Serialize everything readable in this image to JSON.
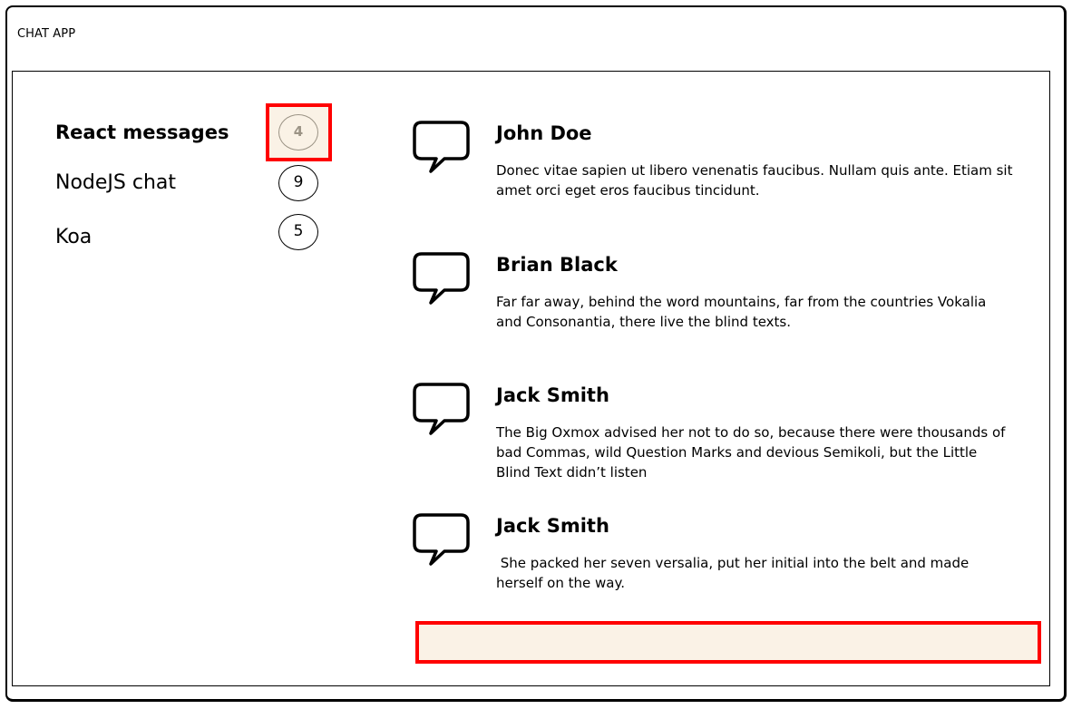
{
  "app": {
    "title": "CHAT APP"
  },
  "sidebar": {
    "channels": [
      {
        "name": "React messages",
        "count": "4",
        "active": true
      },
      {
        "name": "NodeJS chat",
        "count": "9",
        "active": false
      },
      {
        "name": "Koa",
        "count": "5",
        "active": false
      }
    ]
  },
  "messages": [
    {
      "icon": "speech-bubble-icon",
      "author": "John Doe",
      "text": "Donec vitae sapien ut libero venenatis faucibus. Nullam quis ante. Etiam sit amet orci eget eros faucibus tincidunt."
    },
    {
      "icon": "speech-bubble-icon",
      "author": "Brian Black",
      "text": "Far far away, behind the word mountains, far from the countries Vokalia and Consonantia, there live the blind texts."
    },
    {
      "icon": "speech-bubble-icon",
      "author": "Jack Smith",
      "text": "The Big Oxmox advised her not to do so, because there were thousands of bad Commas, wild Question Marks and devious Semikoli, but the Little Blind Text didn’t listen"
    },
    {
      "icon": "speech-bubble-icon",
      "author": "Jack Smith",
      "text": " She packed her seven versalia, put her initial into the belt and made herself on the way."
    }
  ],
  "composer": {
    "value": "",
    "placeholder": ""
  },
  "colors": {
    "highlight_border": "#ff0000",
    "highlight_fill": "#faf2e6",
    "active_badge": "#9b9385"
  }
}
